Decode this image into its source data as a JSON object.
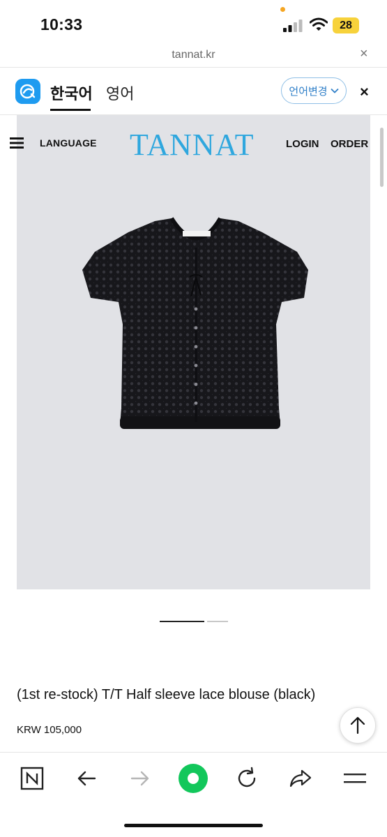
{
  "status_bar": {
    "time": "10:33",
    "battery": "28"
  },
  "url_bar": {
    "url": "tannat.kr",
    "close_glyph": "×"
  },
  "translate_bar": {
    "source_lang": "한국어",
    "target_lang": "영어",
    "change_label": "언어변경",
    "close_glyph": "×"
  },
  "site_header": {
    "menu_icon": "hamburger-menu-icon",
    "language_label": "LANGUAGE",
    "logo": "TANNAT",
    "login_label": "LOGIN",
    "order_label": "ORDER",
    "logo_color": "#2fa7de"
  },
  "product_image": {
    "tag_text": "TANNAT"
  },
  "carousel": {
    "total": 2,
    "active_index": 1
  },
  "product": {
    "title": "(1st re-stock) T/T Half sleeve lace blouse (black)",
    "price": "KRW 105,000"
  },
  "scroll_top_button": {
    "icon": "arrow-up-icon"
  },
  "bottom_toolbar": {
    "items": [
      "naver-home-icon",
      "back-arrow-icon",
      "forward-arrow-icon",
      "green-dot-icon",
      "reload-icon",
      "share-icon",
      "menu-icon"
    ],
    "accent": "#12c75b"
  }
}
